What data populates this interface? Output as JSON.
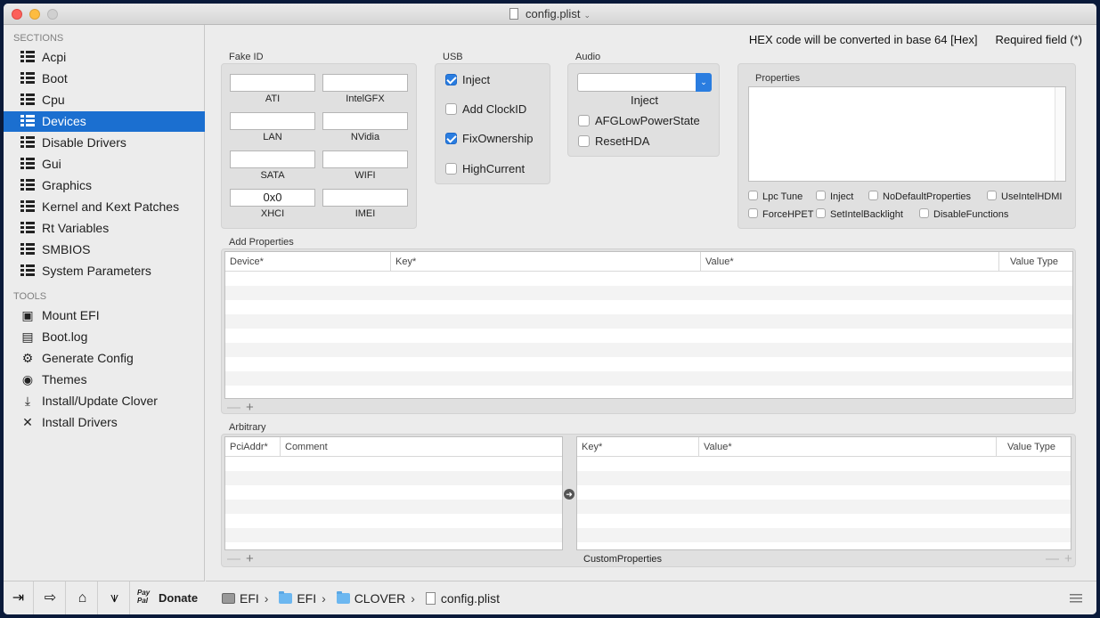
{
  "window": {
    "title": "config.plist"
  },
  "sidebar": {
    "sections_header": "SECTIONS",
    "sections": [
      {
        "label": "Acpi",
        "selected": false
      },
      {
        "label": "Boot",
        "selected": false
      },
      {
        "label": "Cpu",
        "selected": false
      },
      {
        "label": "Devices",
        "selected": true
      },
      {
        "label": "Disable Drivers",
        "selected": false
      },
      {
        "label": "Gui",
        "selected": false
      },
      {
        "label": "Graphics",
        "selected": false
      },
      {
        "label": "Kernel and Kext Patches",
        "selected": false
      },
      {
        "label": "Rt Variables",
        "selected": false
      },
      {
        "label": "SMBIOS",
        "selected": false
      },
      {
        "label": "System Parameters",
        "selected": false
      }
    ],
    "tools_header": "TOOLS",
    "tools": [
      {
        "label": "Mount EFI",
        "icon": "disk-icon"
      },
      {
        "label": "Boot.log",
        "icon": "log-icon"
      },
      {
        "label": "Generate Config",
        "icon": "gears-icon"
      },
      {
        "label": "Themes",
        "icon": "palette-icon"
      },
      {
        "label": "Install/Update Clover",
        "icon": "download-icon"
      },
      {
        "label": "Install Drivers",
        "icon": "wrench-icon"
      }
    ],
    "bottom": {
      "donate_label": "Donate",
      "paypal": "Pay Pal"
    }
  },
  "main": {
    "hex_note": "HEX code will be converted in base 64 [Hex]",
    "required_note": "Required field (*)",
    "fake_id": {
      "title": "Fake ID",
      "fields": [
        {
          "label": "ATI",
          "value": ""
        },
        {
          "label": "IntelGFX",
          "value": ""
        },
        {
          "label": "LAN",
          "value": ""
        },
        {
          "label": "NVidia",
          "value": ""
        },
        {
          "label": "SATA",
          "value": ""
        },
        {
          "label": "WIFI",
          "value": ""
        },
        {
          "label": "XHCI",
          "value": "0x0"
        },
        {
          "label": "IMEI",
          "value": ""
        }
      ]
    },
    "usb": {
      "title": "USB",
      "options": [
        {
          "label": "Inject",
          "checked": true
        },
        {
          "label": "Add ClockID",
          "checked": false
        },
        {
          "label": "FixOwnership",
          "checked": true
        },
        {
          "label": "HighCurrent",
          "checked": false
        }
      ]
    },
    "audio": {
      "title": "Audio",
      "inject_label": "Inject",
      "inject_value": "",
      "options": [
        {
          "label": "AFGLowPowerState",
          "checked": false
        },
        {
          "label": "ResetHDA",
          "checked": false
        }
      ]
    },
    "properties": {
      "title": "Properties",
      "options": [
        {
          "label": "Lpc Tune",
          "checked": false
        },
        {
          "label": "Inject",
          "checked": false
        },
        {
          "label": "NoDefaultProperties",
          "checked": false
        },
        {
          "label": "UseIntelHDMI",
          "checked": false
        },
        {
          "label": "ForceHPET",
          "checked": false
        },
        {
          "label": "SetIntelBacklight",
          "checked": false
        },
        {
          "label": "DisableFunctions",
          "checked": false
        }
      ]
    },
    "add_properties": {
      "title": "Add Properties",
      "columns": [
        "Device*",
        "Key*",
        "Value*",
        "Value Type"
      ]
    },
    "arbitrary": {
      "title": "Arbitrary",
      "left_columns": [
        "PciAddr*",
        "Comment"
      ],
      "right_columns": [
        "Key*",
        "Value*",
        "Value Type"
      ],
      "custom_label": "CustomProperties"
    }
  },
  "footer": {
    "path": [
      "EFI",
      "EFI",
      "CLOVER",
      "config.plist"
    ]
  }
}
